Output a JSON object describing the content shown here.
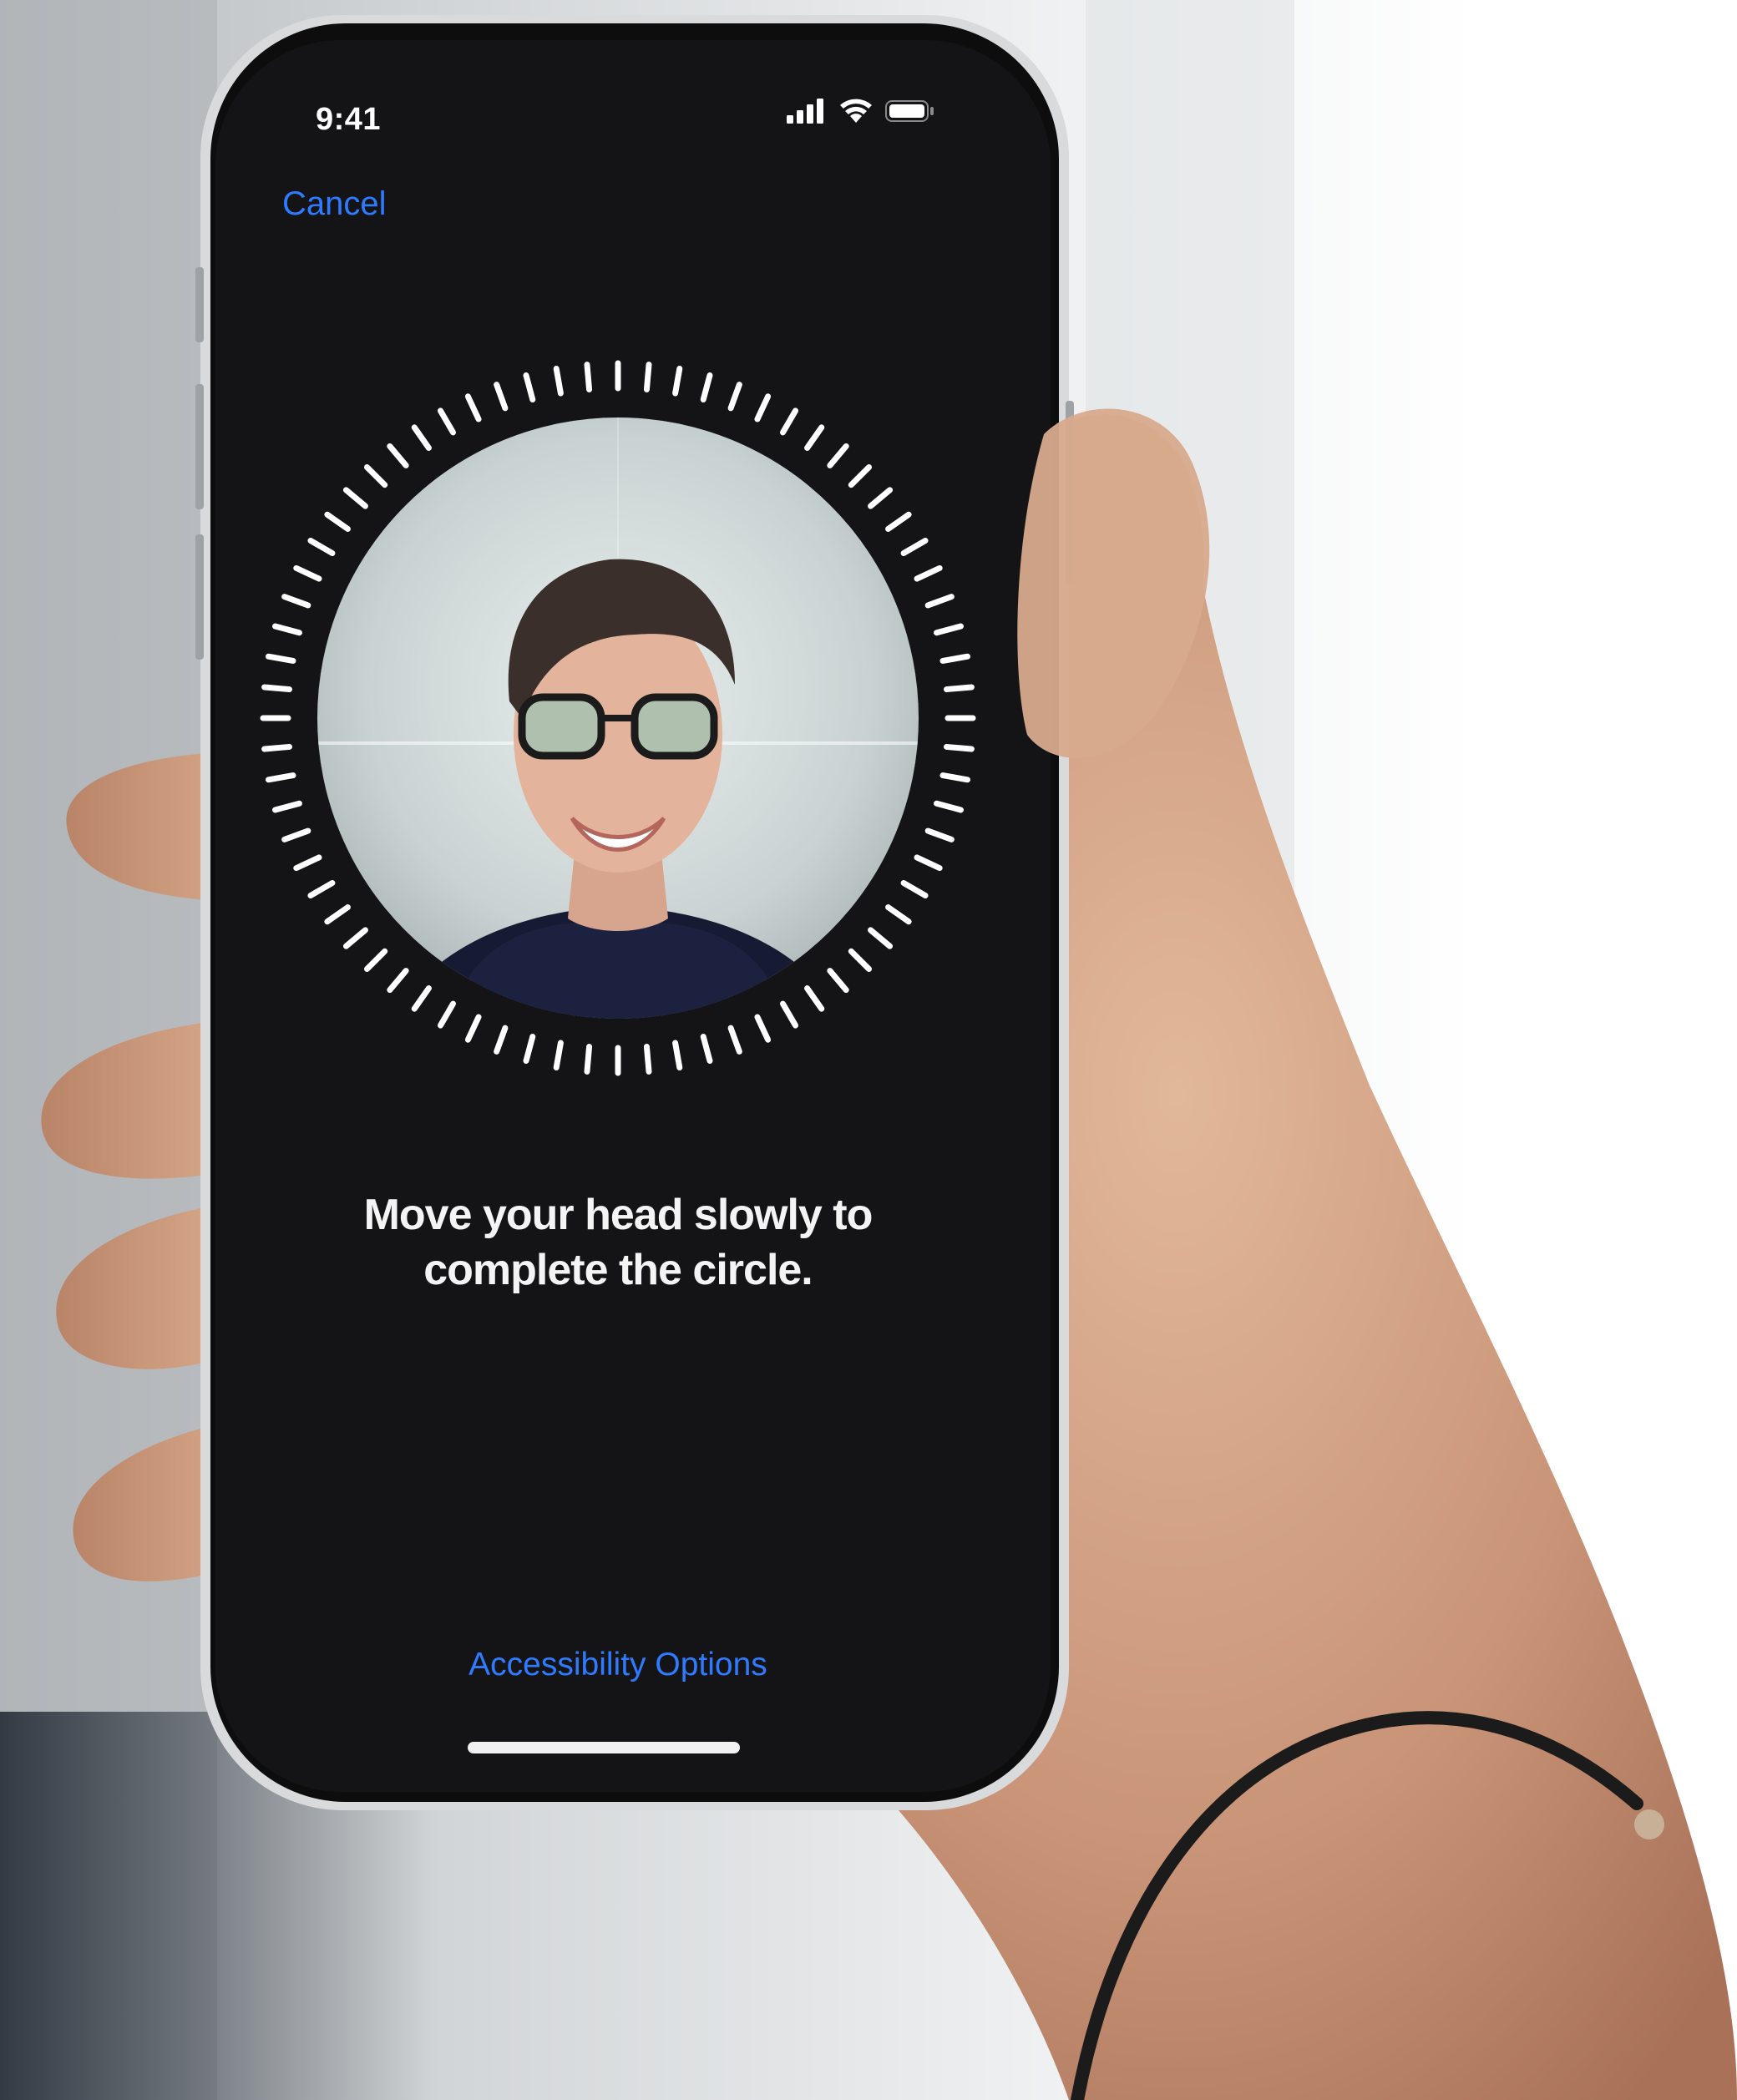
{
  "status_bar": {
    "time": "9:41",
    "signal_icon": "cellular-signal-icon",
    "wifi_icon": "wifi-icon",
    "battery_icon": "battery-icon"
  },
  "nav": {
    "cancel_label": "Cancel"
  },
  "face_scan": {
    "instruction_line1": "Move your head slowly to",
    "instruction_line2": "complete the circle."
  },
  "footer": {
    "accessibility_label": "Accessibility Options"
  },
  "colors": {
    "accent": "#2f7bff",
    "screen_background": "#141416",
    "text_primary": "#f4f4f4"
  }
}
